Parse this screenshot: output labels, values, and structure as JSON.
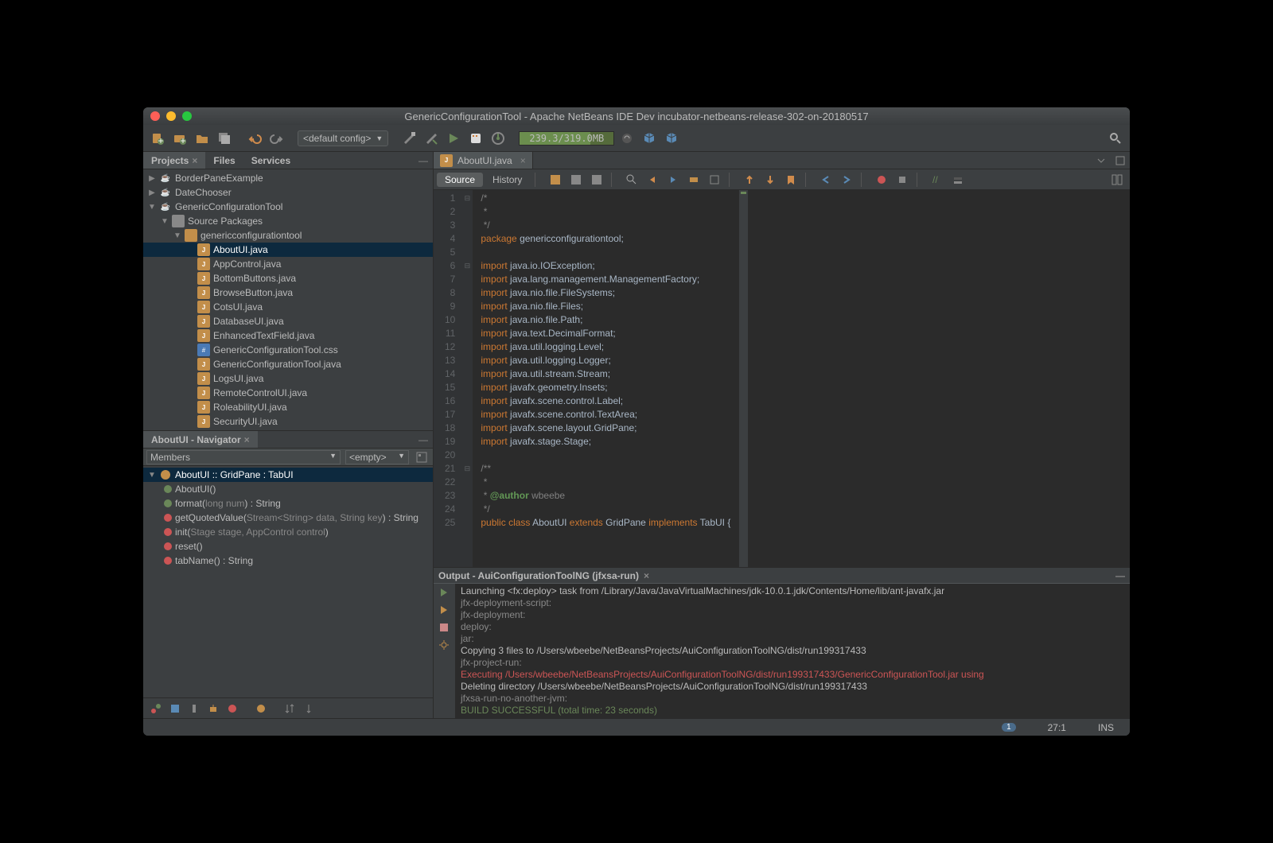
{
  "title": "GenericConfigurationTool - Apache NetBeans IDE Dev incubator-netbeans-release-302-on-20180517",
  "toolbar": {
    "config": "<default config>",
    "memory": "239.3/319.0MB"
  },
  "left_tabs": {
    "projects": "Projects",
    "files": "Files",
    "services": "Services"
  },
  "projects": [
    {
      "indent": 0,
      "tw": "▶",
      "icon": "prj",
      "label": "BorderPaneExample"
    },
    {
      "indent": 0,
      "tw": "▶",
      "icon": "prj",
      "label": "DateChooser"
    },
    {
      "indent": 0,
      "tw": "▼",
      "icon": "prj",
      "label": "GenericConfigurationTool"
    },
    {
      "indent": 1,
      "tw": "▼",
      "icon": "src",
      "label": "Source Packages"
    },
    {
      "indent": 2,
      "tw": "▼",
      "icon": "pkg",
      "label": "genericconfigurationtool"
    },
    {
      "indent": 3,
      "tw": "",
      "icon": "java",
      "label": "AboutUI.java",
      "sel": true
    },
    {
      "indent": 3,
      "tw": "",
      "icon": "java",
      "label": "AppControl.java"
    },
    {
      "indent": 3,
      "tw": "",
      "icon": "java",
      "label": "BottomButtons.java"
    },
    {
      "indent": 3,
      "tw": "",
      "icon": "java",
      "label": "BrowseButton.java"
    },
    {
      "indent": 3,
      "tw": "",
      "icon": "java",
      "label": "CotsUI.java"
    },
    {
      "indent": 3,
      "tw": "",
      "icon": "java",
      "label": "DatabaseUI.java"
    },
    {
      "indent": 3,
      "tw": "",
      "icon": "java",
      "label": "EnhancedTextField.java"
    },
    {
      "indent": 3,
      "tw": "",
      "icon": "css",
      "label": "GenericConfigurationTool.css"
    },
    {
      "indent": 3,
      "tw": "",
      "icon": "java",
      "label": "GenericConfigurationTool.java"
    },
    {
      "indent": 3,
      "tw": "",
      "icon": "java",
      "label": "LogsUI.java"
    },
    {
      "indent": 3,
      "tw": "",
      "icon": "java",
      "label": "RemoteControlUI.java"
    },
    {
      "indent": 3,
      "tw": "",
      "icon": "java",
      "label": "RoleabilityUI.java"
    },
    {
      "indent": 3,
      "tw": "",
      "icon": "java",
      "label": "SecurityUI.java"
    }
  ],
  "nav": {
    "title": "AboutUI - Navigator",
    "members_label": "Members",
    "empty_label": "<empty>",
    "header": "AboutUI :: GridPane : TabUI",
    "items": [
      {
        "dot": "g",
        "html": "AboutUI()"
      },
      {
        "dot": "g",
        "html": "format(<span class='m-sig'>long num</span>) : String"
      },
      {
        "dot": "r",
        "html": "getQuotedValue(<span class='m-sig'>Stream&lt;String&gt; data, String key</span>) : String"
      },
      {
        "dot": "r",
        "html": "init(<span class='m-sig'>Stage stage, AppControl control</span>)"
      },
      {
        "dot": "r",
        "html": "reset()"
      },
      {
        "dot": "r",
        "html": "tabName() : String"
      }
    ]
  },
  "editor": {
    "filename": "AboutUI.java",
    "source_label": "Source",
    "history_label": "History",
    "lines": [
      "<span class='cm'>/*</span>",
      "<span class='cm'> *</span>",
      "<span class='cm'> */</span>",
      "<span class='kw'>package</span> genericconfigurationtool;",
      "",
      "<span class='kw'>import</span> java.io.IOException;",
      "<span class='kw'>import</span> java.lang.management.ManagementFactory;",
      "<span class='kw'>import</span> java.nio.file.FileSystems;",
      "<span class='kw'>import</span> java.nio.file.Files;",
      "<span class='kw'>import</span> java.nio.file.Path;",
      "<span class='kw'>import</span> java.text.DecimalFormat;",
      "<span class='kw'>import</span> java.util.logging.Level;",
      "<span class='kw'>import</span> java.util.logging.Logger;",
      "<span class='kw'>import</span> java.util.stream.Stream;",
      "<span class='kw'>import</span> javafx.geometry.Insets;",
      "<span class='kw'>import</span> javafx.scene.control.Label;",
      "<span class='kw'>import</span> javafx.scene.control.TextArea;",
      "<span class='kw'>import</span> javafx.scene.layout.GridPane;",
      "<span class='kw'>import</span> javafx.stage.Stage;",
      "",
      "<span class='cm'>/**</span>",
      "<span class='cm'> *</span>",
      "<span class='cm'> * <span class='tag'>@author</span> wbeebe</span>",
      "<span class='cm'> */</span>",
      "<span class='kw'>public</span> <span class='kw'>class</span> AboutUI <span class='kw'>extends</span> GridPane <span class='kw'>implements</span> TabUI {"
    ]
  },
  "output": {
    "title": "Output - AuiConfigurationToolNG (jfxsa-run)",
    "lines": [
      {
        "cls": "out-white",
        "text": "Launching <fx:deploy> task from /Library/Java/JavaVirtualMachines/jdk-10.0.1.jdk/Contents/Home/lib/ant-javafx.jar"
      },
      {
        "cls": "out-gray",
        "text": "jfx-deployment-script:"
      },
      {
        "cls": "out-gray",
        "text": "jfx-deployment:"
      },
      {
        "cls": "out-gray",
        "text": "deploy:"
      },
      {
        "cls": "out-gray",
        "text": "jar:"
      },
      {
        "cls": "out-white",
        "text": "Copying 3 files to /Users/wbeebe/NetBeansProjects/AuiConfigurationToolNG/dist/run199317433"
      },
      {
        "cls": "out-gray",
        "text": "jfx-project-run:"
      },
      {
        "cls": "out-red",
        "text": "Executing /Users/wbeebe/NetBeansProjects/AuiConfigurationToolNG/dist/run199317433/GenericConfigurationTool.jar using"
      },
      {
        "cls": "out-white",
        "text": "Deleting directory /Users/wbeebe/NetBeansProjects/AuiConfigurationToolNG/dist/run199317433"
      },
      {
        "cls": "out-gray",
        "text": "jfxsa-run-no-another-jvm:"
      },
      {
        "cls": "out-green",
        "text": "BUILD SUCCESSFUL (total time: 23 seconds)"
      }
    ]
  },
  "status": {
    "notif": "1",
    "pos": "27:1",
    "mode": "INS"
  }
}
